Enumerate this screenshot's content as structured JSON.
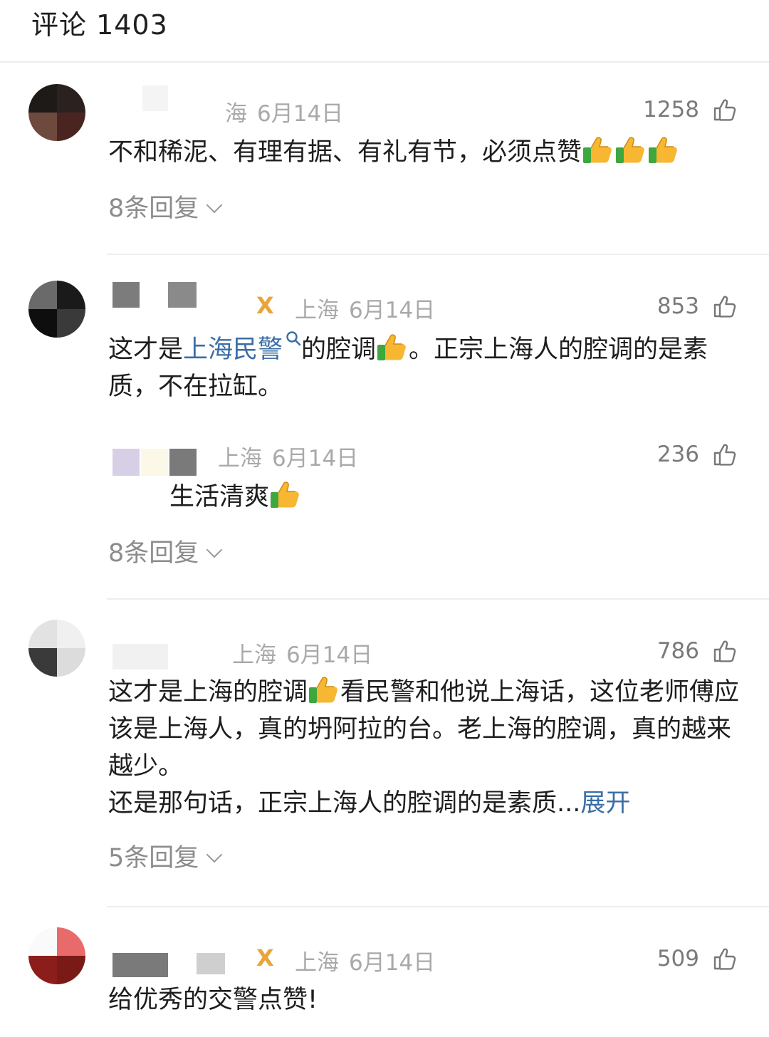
{
  "header": {
    "title": "评论 1403"
  },
  "comments": [
    {
      "location": "海",
      "date": "6月14日",
      "likes": "1258",
      "text": "不和稀泥、有理有据、有礼有节，必须点赞",
      "replies": "8条回复"
    },
    {
      "location": "上海",
      "date": "6月14日",
      "likes": "853",
      "text_before": "这才是",
      "topic": "上海民警",
      "text_mid": "的腔调",
      "text_after": "。正宗上海人的腔调的是素质，不在拉缸。",
      "reply": {
        "location": "上海",
        "date": "6月14日",
        "likes": "236",
        "text": "生活清爽"
      },
      "replies": "8条回复"
    },
    {
      "location": "上海",
      "date": "6月14日",
      "likes": "786",
      "text_before": "这才是上海的腔调",
      "text_after": "看民警和他说上海话，这位老师傅应该是上海人，真的坍阿拉的台。老上海的腔调，真的越来越少。",
      "text_line4": "还是那句话，正宗上海人的腔调的是素质...",
      "expand": "展开",
      "replies": "5条回复"
    },
    {
      "location": "上海",
      "date": "6月14日",
      "likes": "509",
      "text": "给优秀的交警点赞!"
    }
  ],
  "icons": {
    "like": "thumbs-up-outline-icon",
    "emoji": "thumbs-up-emoji-icon",
    "badge": "gold-medal-badge-icon",
    "search": "magnifier-icon",
    "chevron": "chevron-down-icon"
  }
}
